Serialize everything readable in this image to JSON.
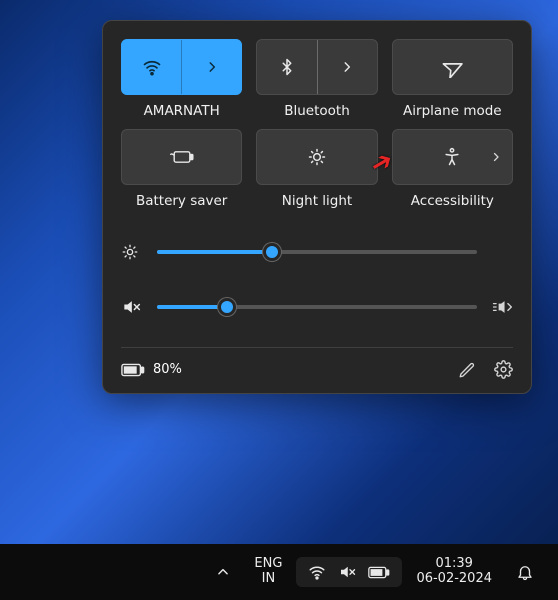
{
  "panel": {
    "tiles": [
      {
        "id": "wifi",
        "label": "AMARNATH",
        "active": true,
        "split": true,
        "sub_arrow": false
      },
      {
        "id": "bluetooth",
        "label": "Bluetooth",
        "active": false,
        "split": true,
        "sub_arrow": false
      },
      {
        "id": "airplane",
        "label": "Airplane mode",
        "active": false,
        "split": false,
        "sub_arrow": false
      },
      {
        "id": "battery",
        "label": "Battery saver",
        "active": false,
        "split": false,
        "sub_arrow": false
      },
      {
        "id": "night",
        "label": "Night light",
        "active": false,
        "split": false,
        "sub_arrow": false
      },
      {
        "id": "a11y",
        "label": "Accessibility",
        "active": false,
        "split": false,
        "sub_arrow": true
      }
    ],
    "brightness_percent": 36,
    "volume_percent": 22,
    "volume_muted": true,
    "battery_text": "80%"
  },
  "taskbar": {
    "lang_line1": "ENG",
    "lang_line2": "IN",
    "time": "01:39",
    "date": "06-02-2024"
  },
  "colors": {
    "accent": "#34a6ff"
  }
}
